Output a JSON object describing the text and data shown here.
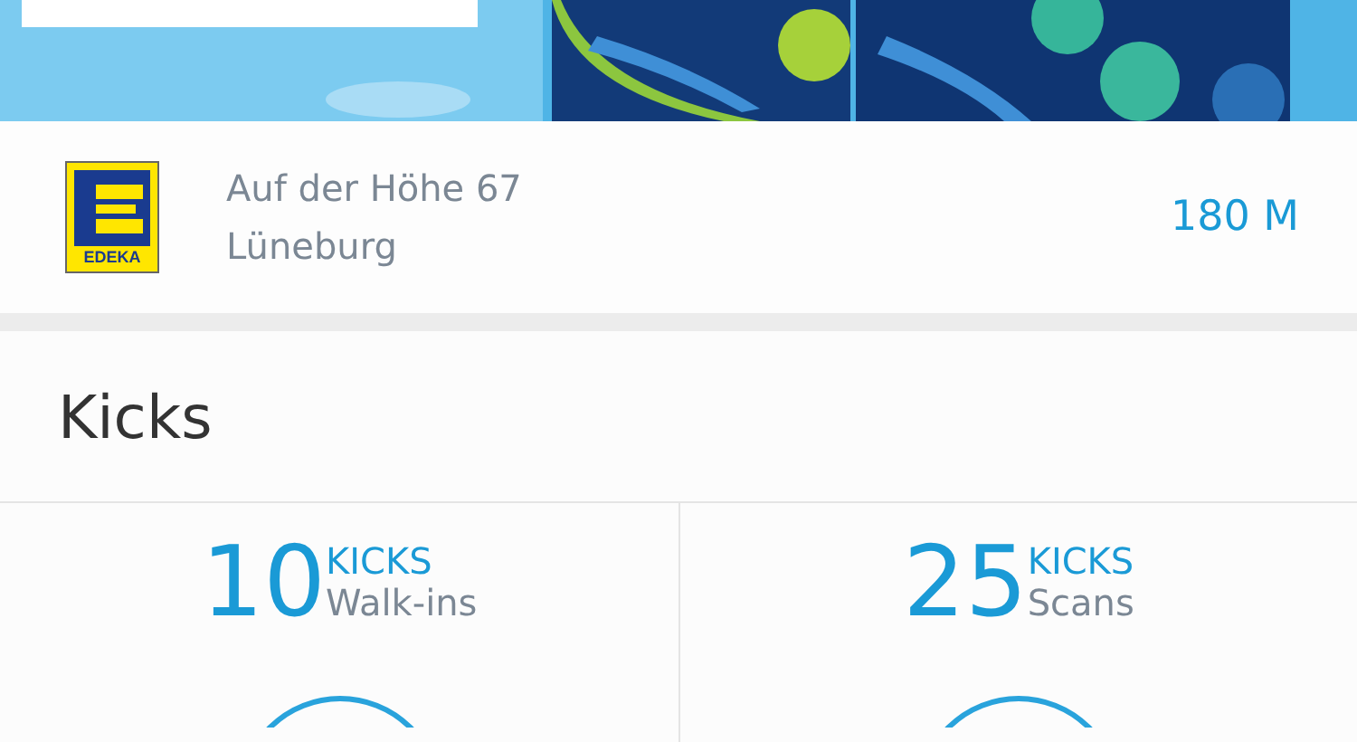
{
  "store": {
    "logo_text": "EDEKA",
    "address_line_1": "Auf der Höhe 67",
    "address_line_2": "Lüneburg",
    "distance": "180 M"
  },
  "kicks": {
    "title": "Kicks",
    "items": [
      {
        "amount": "10",
        "unit": "KICKS",
        "label": "Walk-ins"
      },
      {
        "amount": "25",
        "unit": "KICKS",
        "label": "Scans"
      }
    ]
  }
}
